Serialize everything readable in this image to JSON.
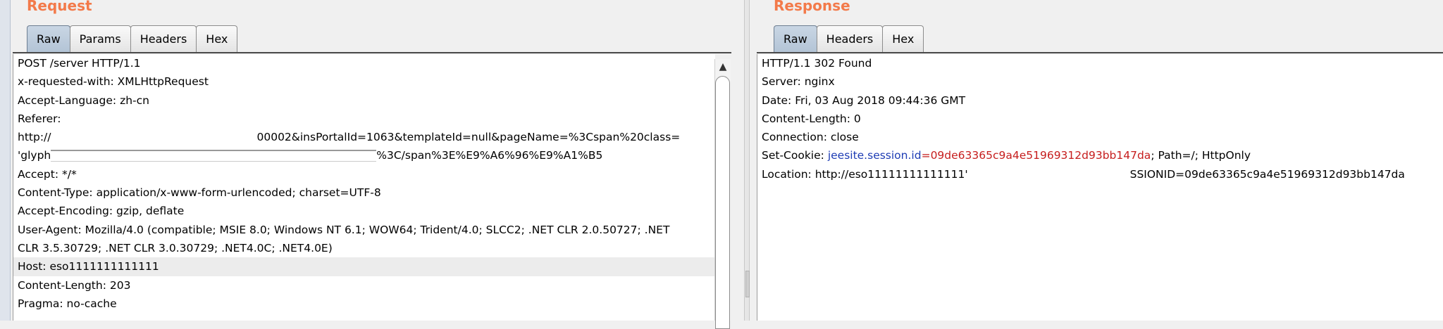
{
  "request": {
    "title": "Request",
    "tabs": [
      "Raw",
      "Params",
      "Headers",
      "Hex"
    ],
    "active_tab": "Raw",
    "lines": [
      "POST /server HTTP/1.1",
      "x-requested-with: XMLHttpRequest",
      "Accept-Language: zh-cn",
      "Referer:",
      "http://",
      "00002&insPortalId=1063&templateId=null&pageName=%3Cspan%20class=",
      "'glyph",
      "%3C/span%3E%E9%A6%96%E9%A1%B5",
      "Accept: */*",
      "Content-Type: application/x-www-form-urlencoded; charset=UTF-8",
      "Accept-Encoding: gzip, deflate",
      "User-Agent: Mozilla/4.0 (compatible; MSIE 8.0; Windows NT 6.1; WOW64; Trident/4.0; SLCC2; .NET CLR 2.0.50727; .NET",
      "CLR 3.5.30729; .NET CLR 3.0.30729; .NET4.0C; .NET4.0E)",
      "Host: eso1111111111111",
      "Content-Length: 203",
      "Pragma: no-cache"
    ],
    "scroll_up_arrow": "▲"
  },
  "response": {
    "title": "Response",
    "tabs": [
      "Raw",
      "Headers",
      "Hex"
    ],
    "active_tab": "Raw",
    "lines": [
      "HTTP/1.1 302 Found",
      "Server: nginx",
      "Date: Fri, 03 Aug 2018 09:44:36 GMT",
      "Content-Length: 0",
      "Connection: close"
    ],
    "cookie": {
      "prefix": "Set-Cookie: ",
      "name": "jeesite.session.id",
      "eq": "=",
      "value": "09de63365c9a4e51969312d93bb147da",
      "suffix": "; Path=/; HttpOnly"
    },
    "location": {
      "prefix": "Location: http://eso11111111111111'",
      "suffix": "SSIONID=09de63365c9a4e51969312d93bb147da"
    }
  },
  "colors": {
    "title": "#f37a4a",
    "cookie_name": "#1d3cb4",
    "cookie_value": "#c61d1d"
  }
}
